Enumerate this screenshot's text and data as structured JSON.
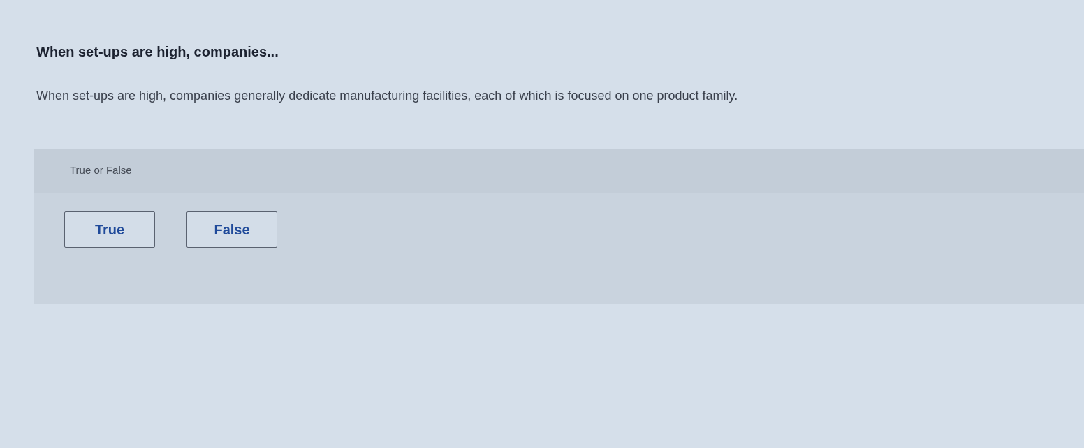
{
  "question": {
    "title": "When set-ups are high, companies...",
    "text": "When set-ups are high, companies generally dedicate manufacturing facilities, each of which is focused on one product family."
  },
  "answer_panel": {
    "prompt": "True or False",
    "options": [
      {
        "label": "True",
        "selected": false
      },
      {
        "label": "False",
        "selected": false
      }
    ]
  }
}
